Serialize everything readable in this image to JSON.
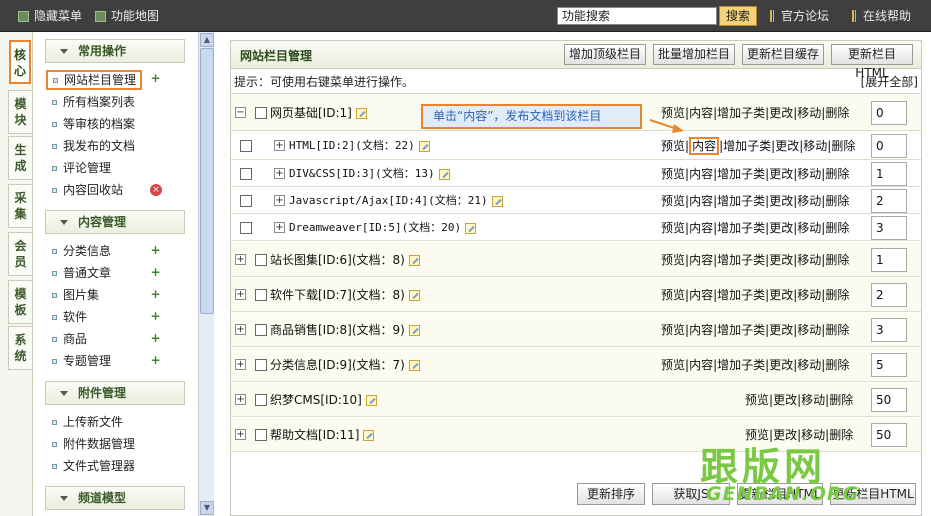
{
  "topbar": {
    "hide_menu": "隐藏菜单",
    "sitemap": "功能地图",
    "search_value": "功能搜索",
    "search_button": "搜索",
    "forum": "官方论坛",
    "help": "在线帮助"
  },
  "left_tabs": [
    "核\n心",
    "模\n块",
    "生\n成",
    "采\n集",
    "会\n员",
    "模\n板",
    "系\n统"
  ],
  "menu": {
    "sections": [
      {
        "title": "常用操作",
        "items": [
          "网站栏目管理",
          "所有档案列表",
          "等审核的档案",
          "我发布的文档",
          "评论管理",
          "内容回收站"
        ]
      },
      {
        "title": "内容管理",
        "items": [
          "分类信息",
          "普通文章",
          "图片集",
          "软件",
          "商品",
          "专题管理"
        ]
      },
      {
        "title": "附件管理",
        "items": [
          "上传新文件",
          "附件数据管理",
          "文件式管理器"
        ]
      },
      {
        "title": "频道模型",
        "items": []
      }
    ]
  },
  "main": {
    "title": "网站栏目管理",
    "buttons": [
      "增加顶级栏目",
      "批量增加栏目",
      "更新栏目缓存",
      "更新栏目HTML"
    ],
    "tip": "提示：可使用右键菜单进行操作。",
    "expand_all": "[展开全部]",
    "callout": "单击“内容”，发布文档到该栏目",
    "ops_full": [
      "预览",
      "内容",
      "增加子类",
      "更改",
      "移动",
      "删除"
    ],
    "ops_short": [
      "预览",
      "更改",
      "移动",
      "删除"
    ],
    "rows": [
      {
        "name": "网页基础[ID:1]",
        "order": "0"
      },
      {
        "name": "HTML[ID:2](文档：22)",
        "order": "0"
      },
      {
        "name": "DIV&CSS[ID:3](文档：13)",
        "order": "1"
      },
      {
        "name": "Javascript/Ajax[ID:4](文档：21)",
        "order": "2"
      },
      {
        "name": "Dreamweaver[ID:5](文档：20)",
        "order": "3"
      },
      {
        "name": "站长图集[ID:6](文档：8)",
        "order": "1"
      },
      {
        "name": "软件下载[ID:7](文档：8)",
        "order": "2"
      },
      {
        "name": "商品销售[ID:8](文档：9)",
        "order": "3"
      },
      {
        "name": "分类信息[ID:9](文档：7)",
        "order": "5"
      },
      {
        "name": "织梦CMS[ID:10]",
        "order": "50"
      },
      {
        "name": "帮助文档[ID:11]",
        "order": "50"
      }
    ],
    "bottom_buttons": [
      "更新排序",
      "获取JS",
      "更新栏目HTML",
      "更新栏目HTML"
    ]
  },
  "watermark": {
    "cn": "跟版网",
    "en": "GENBAN.ORG"
  }
}
